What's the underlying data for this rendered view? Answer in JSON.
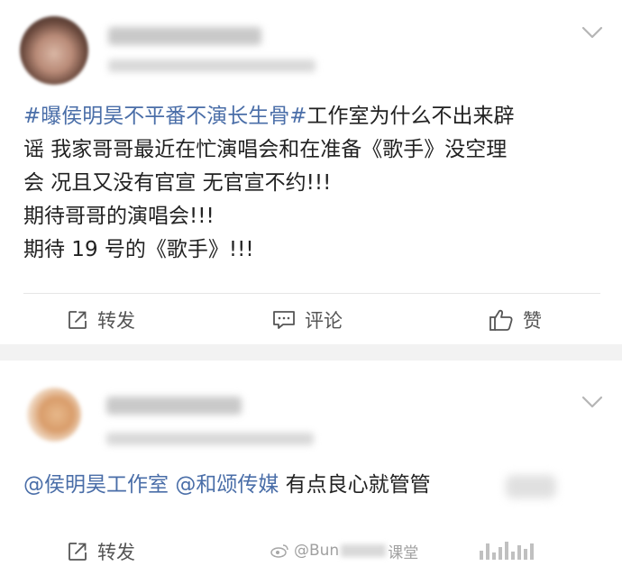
{
  "post1": {
    "hashtag": "#曝侯明昊不平番不演长生骨#",
    "text_line1": "工作室为什么不出来辟",
    "text_line2": "谣 我家哥哥最近在忙演唱会和在准备《歌手》没空理",
    "text_line3": "会 况且又没有官宣 无官宣不约!!!",
    "text_line4": "期待哥哥的演唱会!!!",
    "text_line5": "期待 19 号的《歌手》!!!",
    "actions": {
      "repost": "转发",
      "comment": "评论",
      "like": "赞"
    }
  },
  "post2": {
    "mention1": "@侯明昊工作室",
    "mention2": "@和颂传媒",
    "text": "有点良心就管管",
    "actions": {
      "repost": "转发"
    }
  },
  "watermark": {
    "text": "@Bun",
    "text_tail": "课堂"
  },
  "icons": {
    "repost": "repost-icon",
    "comment": "comment-icon",
    "like": "thumbs-up-icon",
    "menu": "chevron-down-icon"
  },
  "colors": {
    "link": "#4a6ea8",
    "text": "#222222",
    "action": "#555555",
    "separator": "#f2f2f2"
  }
}
